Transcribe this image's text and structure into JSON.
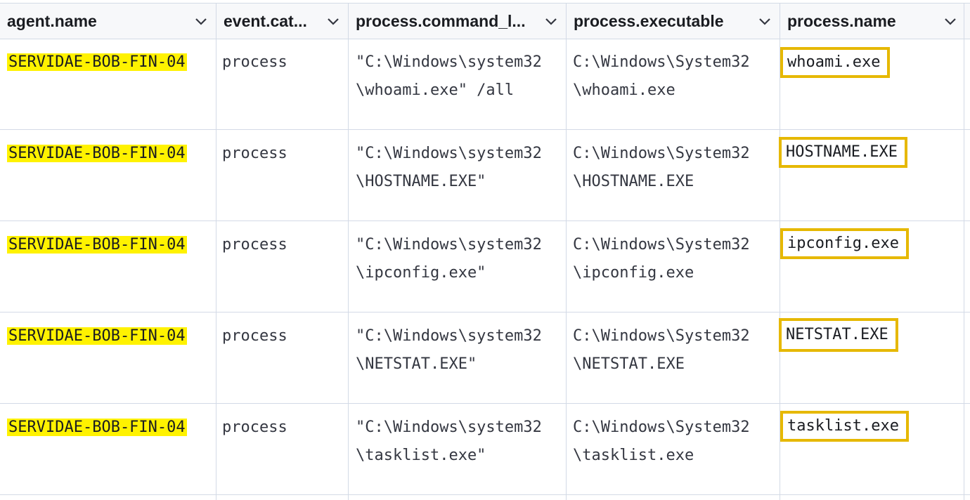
{
  "columns": [
    {
      "label": "agent.name"
    },
    {
      "label": "event.cat..."
    },
    {
      "label": "process.command_l..."
    },
    {
      "label": "process.executable"
    },
    {
      "label": "process.name"
    }
  ],
  "rows": [
    {
      "agent": "SERVIDAE-BOB-FIN-04",
      "category": "process",
      "cmd_line1": "\"C:\\Windows\\system32",
      "cmd_line2": "\\whoami.exe\" /all",
      "exe_line1": "C:\\Windows\\System32",
      "exe_line2": "\\whoami.exe",
      "name": "whoami.exe"
    },
    {
      "agent": "SERVIDAE-BOB-FIN-04",
      "category": "process",
      "cmd_line1": "\"C:\\Windows\\system32",
      "cmd_line2": "\\HOSTNAME.EXE\"",
      "exe_line1": "C:\\Windows\\System32",
      "exe_line2": "\\HOSTNAME.EXE",
      "name": "HOSTNAME.EXE"
    },
    {
      "agent": "SERVIDAE-BOB-FIN-04",
      "category": "process",
      "cmd_line1": "\"C:\\Windows\\system32",
      "cmd_line2": "\\ipconfig.exe\"",
      "exe_line1": "C:\\Windows\\System32",
      "exe_line2": "\\ipconfig.exe",
      "name": "ipconfig.exe"
    },
    {
      "agent": "SERVIDAE-BOB-FIN-04",
      "category": "process",
      "cmd_line1": "\"C:\\Windows\\system32",
      "cmd_line2": "\\NETSTAT.EXE\"",
      "exe_line1": "C:\\Windows\\System32",
      "exe_line2": "\\NETSTAT.EXE",
      "name": "NETSTAT.EXE"
    },
    {
      "agent": "SERVIDAE-BOB-FIN-04",
      "category": "process",
      "cmd_line1": "\"C:\\Windows\\system32",
      "cmd_line2": "\\tasklist.exe\"",
      "exe_line1": "C:\\Windows\\System32",
      "exe_line2": "\\tasklist.exe",
      "name": "tasklist.exe"
    }
  ],
  "icons": {
    "column_menu": "chevron-down-icon"
  },
  "colors": {
    "highlight": "#fff200",
    "box": "#e6b800",
    "border": "#d3dae6"
  }
}
